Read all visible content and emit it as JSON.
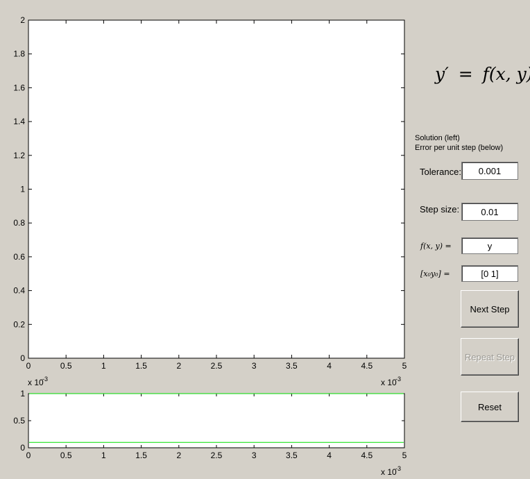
{
  "equation": {
    "lhs": "y′",
    "eq": "=",
    "rhs": "f(x, y)"
  },
  "info": {
    "line1": "Solution (left)",
    "line2": "Error per unit step (below)"
  },
  "tolerance": {
    "label": "Tolerance:",
    "value": "0.001"
  },
  "step_size": {
    "label": "Step size:",
    "value": "0.01"
  },
  "function": {
    "label": "f(x, y) =",
    "value": "y"
  },
  "initial": {
    "label": "[x₀y₀] =",
    "value": "[0 1]"
  },
  "buttons": {
    "next": "Next Step",
    "repeat": "Repeat Step",
    "reset": "Reset"
  },
  "colors": {
    "error_line": "#00dd00"
  },
  "chart_data": [
    {
      "type": "line",
      "x_ticks": [
        "0",
        "0.5",
        "1",
        "1.5",
        "2",
        "2.5",
        "3",
        "3.5",
        "4",
        "4.5",
        "5"
      ],
      "y_ticks": [
        "0",
        "0.2",
        "0.4",
        "0.6",
        "0.8",
        "1",
        "1.2",
        "1.4",
        "1.6",
        "1.8",
        "2"
      ],
      "x_exponent": "x 10",
      "x_exponent_power": "-3",
      "y_exponent": "x 10",
      "y_exponent_power": "-3",
      "xlim": [
        0,
        5
      ],
      "ylim": [
        0,
        2
      ],
      "series": []
    },
    {
      "type": "line",
      "x_ticks": [
        "0",
        "0.5",
        "1",
        "1.5",
        "2",
        "2.5",
        "3",
        "3.5",
        "4",
        "4.5",
        "5"
      ],
      "y_ticks": [
        "0",
        "0.5",
        "1"
      ],
      "x_exponent": "x 10",
      "x_exponent_power": "-3",
      "xlim": [
        0,
        5
      ],
      "ylim": [
        0,
        1
      ],
      "hlines": [
        0.1,
        1.0
      ]
    }
  ]
}
